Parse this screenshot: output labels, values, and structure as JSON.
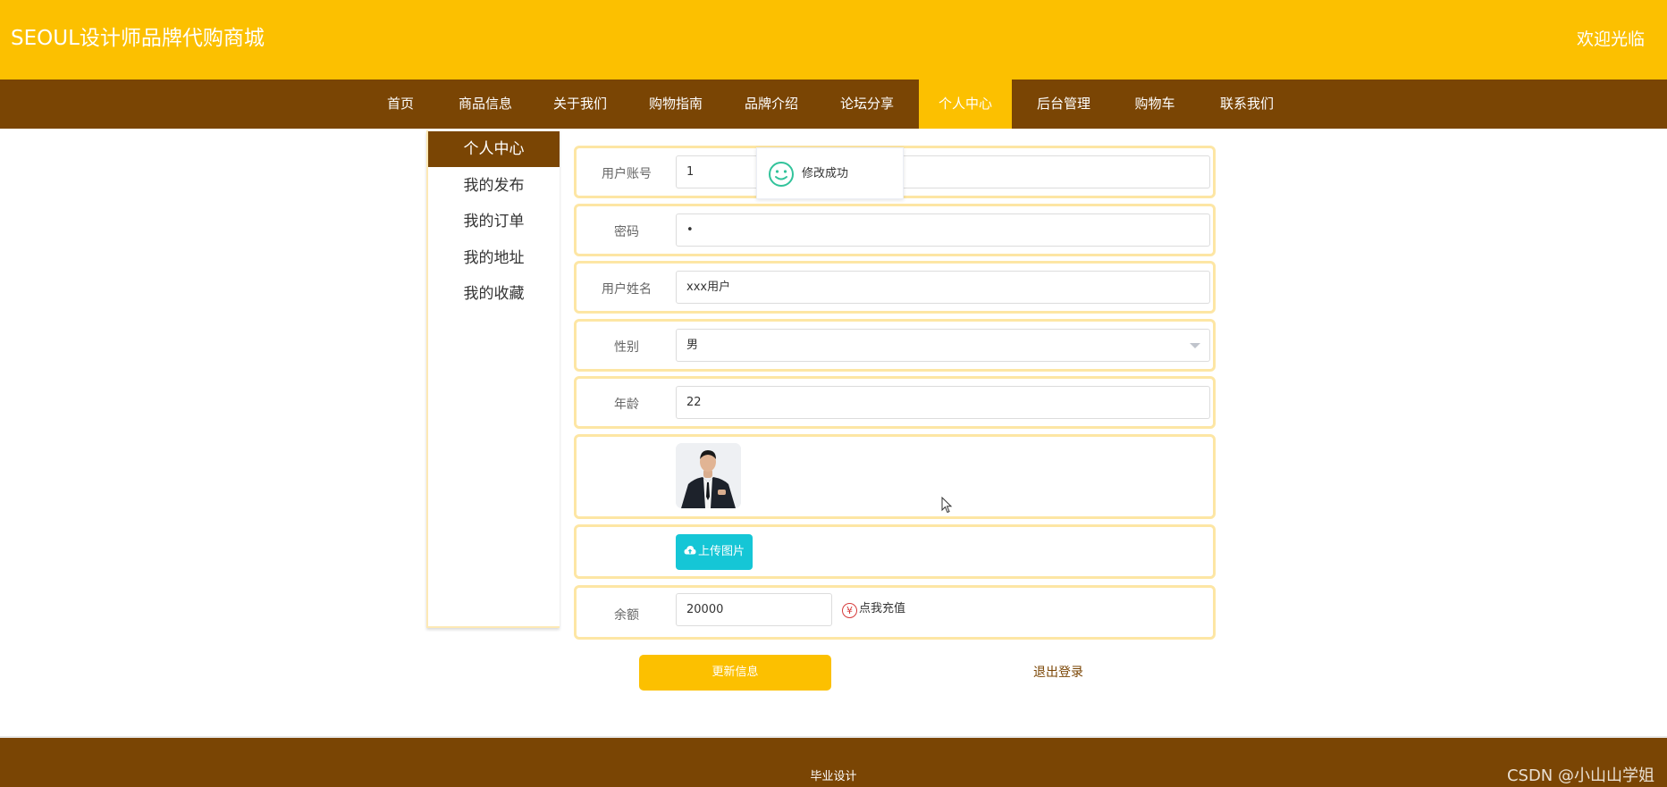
{
  "colors": {
    "brand_yellow": "#fcc000",
    "nav_brown": "#7a4504",
    "upload_teal": "#15c6d6",
    "toast_green": "#32c39b",
    "row_border": "#fde6a4"
  },
  "header": {
    "title": "SEOUL设计师品牌代购商城",
    "welcome": "欢迎光临"
  },
  "nav": {
    "items": [
      "首页",
      "商品信息",
      "关于我们",
      "购物指南",
      "品牌介绍",
      "论坛分享",
      "个人中心",
      "后台管理",
      "购物车",
      "联系我们"
    ],
    "active": "个人中心"
  },
  "sidebar": {
    "items": [
      "个人中心",
      "我的发布",
      "我的订单",
      "我的地址",
      "我的收藏"
    ],
    "active": "个人中心"
  },
  "form": {
    "username_label": "用户账号",
    "username_value": "1",
    "password_label": "密码",
    "password_value": "•",
    "realname_label": "用户姓名",
    "realname_value": "xxx用户",
    "gender_label": "性别",
    "gender_value": "男",
    "age_label": "年龄",
    "age_value": "22",
    "upload_label": "上传图片",
    "balance_label": "余额",
    "balance_value": "20000",
    "recharge_label": "点我充值",
    "recharge_icon": "¥"
  },
  "actions": {
    "update_label": "更新信息",
    "logout_label": "退出登录"
  },
  "toast": {
    "message": "修改成功",
    "icon": "smile-icon"
  },
  "footer": {
    "text": "毕业设计",
    "watermark": "CSDN @小山山学姐"
  }
}
